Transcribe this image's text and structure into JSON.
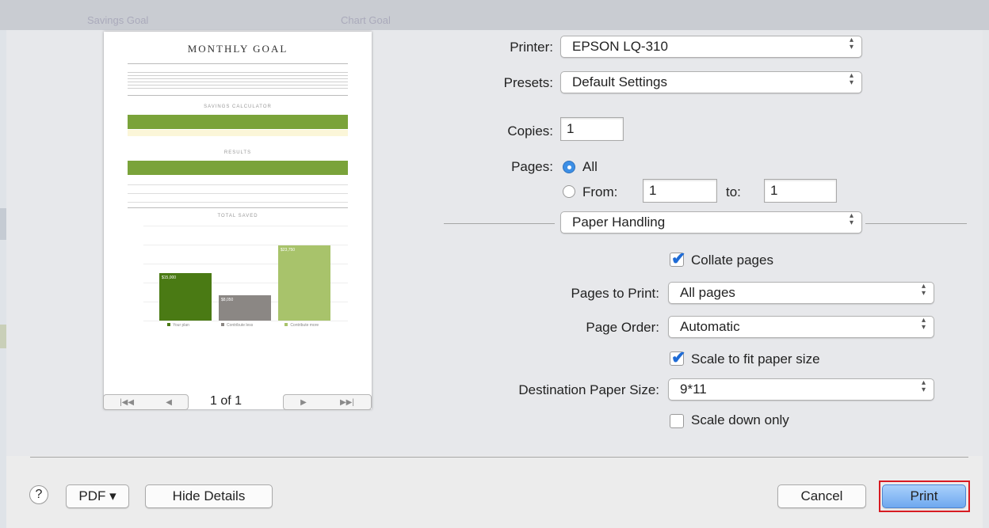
{
  "window": {
    "background_tabs": [
      "Savings Goal",
      "Chart Goal"
    ]
  },
  "preview": {
    "doc_title": "MONTHLY GOAL",
    "section_calculator": "SAVINGS CALCULATOR",
    "section_results": "RESULTS",
    "section_total": "TOTAL SAVED",
    "chart_data": {
      "type": "bar",
      "categories": [
        "Your plan",
        "Contribute less",
        "Contribute more"
      ],
      "values": [
        15000,
        8050,
        23750
      ],
      "bar_labels": [
        "$15,000",
        "$8,050",
        "$23,750"
      ],
      "colors": [
        "#4a7a14",
        "#8b8784",
        "#a8c36b"
      ],
      "ylim": [
        0,
        25000
      ]
    },
    "nav": {
      "first": "|◀◀",
      "prev": "◀",
      "next": "▶",
      "last": "▶▶|"
    },
    "page_indicator": "1 of 1"
  },
  "printer": {
    "label": "Printer:",
    "value": "EPSON LQ-310"
  },
  "presets": {
    "label": "Presets:",
    "value": "Default Settings"
  },
  "copies": {
    "label": "Copies:",
    "value": "1"
  },
  "pages": {
    "label": "Pages:",
    "all_label": "All",
    "from_label": "From:",
    "from_value": "1",
    "to_label": "to:",
    "to_value": "1"
  },
  "section_popup": {
    "value": "Paper Handling"
  },
  "paper_handling": {
    "collate_label": "Collate pages",
    "collate_checked": true,
    "pages_to_print_label": "Pages to Print:",
    "pages_to_print_value": "All pages",
    "page_order_label": "Page Order:",
    "page_order_value": "Automatic",
    "scale_fit_label": "Scale to fit paper size",
    "scale_fit_checked": true,
    "dest_size_label": "Destination Paper Size:",
    "dest_size_value": "9*11",
    "scale_down_label": "Scale down only",
    "scale_down_checked": false
  },
  "footer": {
    "help": "?",
    "pdf": "PDF ▾",
    "hide_details": "Hide Details",
    "cancel": "Cancel",
    "print": "Print"
  }
}
